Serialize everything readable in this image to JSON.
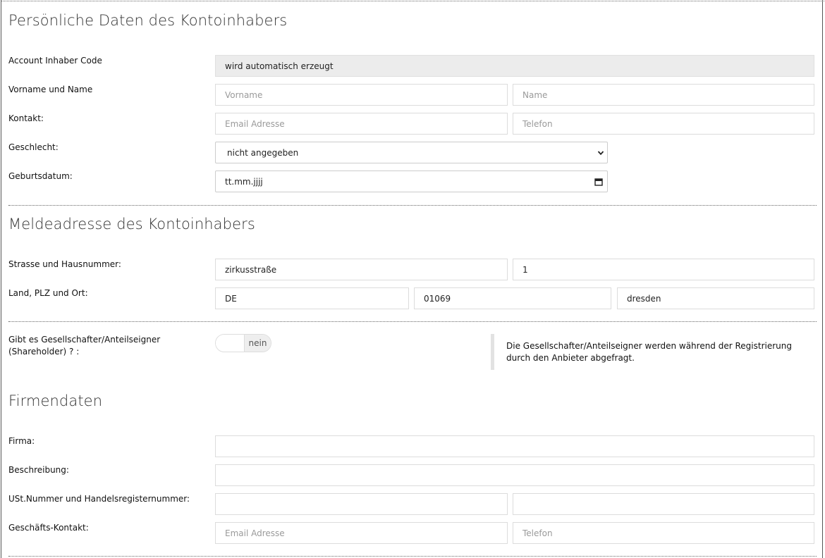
{
  "sections": {
    "personal_title": "Persönliche Daten des Kontoinhabers",
    "address_title": "Meldeadresse des Kontoinhabers",
    "company_title": "Firmendaten"
  },
  "personal": {
    "account_code_label": "Account Inhaber Code",
    "account_code_value": "wird automatisch erzeugt",
    "name_label": "Vorname und Name",
    "firstname_placeholder": "Vorname",
    "lastname_placeholder": "Name",
    "contact_label": "Kontakt:",
    "email_placeholder": "Email Adresse",
    "phone_placeholder": "Telefon",
    "gender_label": "Geschlecht:",
    "gender_selected": "nicht angegeben",
    "birthdate_label": "Geburtsdatum:",
    "birthdate_placeholder": "tt.mm.jjjj"
  },
  "address": {
    "street_label": "Strasse und Hausnummer:",
    "street_value": "zirkusstraße",
    "house_number_value": "1",
    "country_label": "Land, PLZ und Ort:",
    "country_value": "DE",
    "zip_value": "01069",
    "city_value": "dresden"
  },
  "shareholder": {
    "label": "Gibt es Gesellschafter/Anteilseigner (Shareholder) ? :",
    "toggle_state": "nein",
    "note": "Die Gesellschafter/Anteilseigner werden während der Registrierung durch den Anbieter abgefragt."
  },
  "company": {
    "company_label": "Firma:",
    "company_value": "",
    "description_label": "Beschreibung:",
    "description_value": "",
    "vat_label": "USt.Nummer und Handelsregisternummer:",
    "vat_value": "",
    "register_value": "",
    "business_contact_label": "Geschäfts-Kontakt:",
    "business_email_placeholder": "Email Adresse",
    "business_phone_placeholder": "Telefon"
  }
}
